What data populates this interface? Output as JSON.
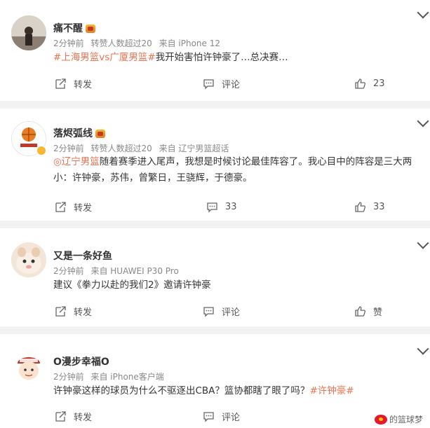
{
  "posts": [
    {
      "user": "痛不醒",
      "meta": [
        "2分钟前",
        "转赞人数超过20",
        "来自 iPhone 12"
      ],
      "content_parts": [
        {
          "text": "#上海男篮vs广厦男篮#",
          "topic": true
        },
        {
          "text": "我开始害怕许钟豪了…总决赛…",
          "topic": false
        }
      ],
      "actions": {
        "repost": "转发",
        "comment": "评论",
        "like": "23"
      }
    },
    {
      "user": "落烬弧线",
      "meta": [
        "2分钟前",
        "转赞人数超过20",
        "来自 辽宁男篮超话"
      ],
      "content_parts": [
        {
          "text": "◎辽宁男篮",
          "topic": true
        },
        {
          "text": "随着赛季进入尾声，我想是时候讨论最佳阵容了。我心目中的阵容是三大两小：许钟豪，苏伟，曾繁日，王骁辉，于德豪。",
          "topic": false
        }
      ],
      "actions": {
        "repost": "转发",
        "comment": "33",
        "like": "33"
      }
    },
    {
      "user": "又是一条好鱼",
      "meta": [
        "2分钟前",
        "来自 HUAWEI P30 Pro"
      ],
      "content_parts": [
        {
          "text": "建议《拳力以赴的我们2》邀请许钟豪",
          "topic": false
        }
      ],
      "actions": {
        "repost": "转发",
        "comment": "评论",
        "like": "赞"
      }
    },
    {
      "user": "O漫步幸福O",
      "meta": [
        "2分钟前",
        "来自 iPhone客户端"
      ],
      "content_parts": [
        {
          "text": "许钟豪这样的球员为什么不驱逐出CBA？篮协都瞎了眼了吗？",
          "topic": false
        },
        {
          "text": "#许钟豪#",
          "topic": true
        }
      ],
      "actions": {
        "repost": "转发",
        "comment": "评论",
        "like": ""
      }
    }
  ],
  "watermark": "的篮球梦",
  "icons": {
    "repost": "repost-icon",
    "comment": "comment-icon",
    "like": "thumbs-up-icon",
    "more": "chevron-down-icon"
  },
  "colors": {
    "topic": "#eb7350",
    "background": "#f2f2f2",
    "card": "#ffffff"
  }
}
